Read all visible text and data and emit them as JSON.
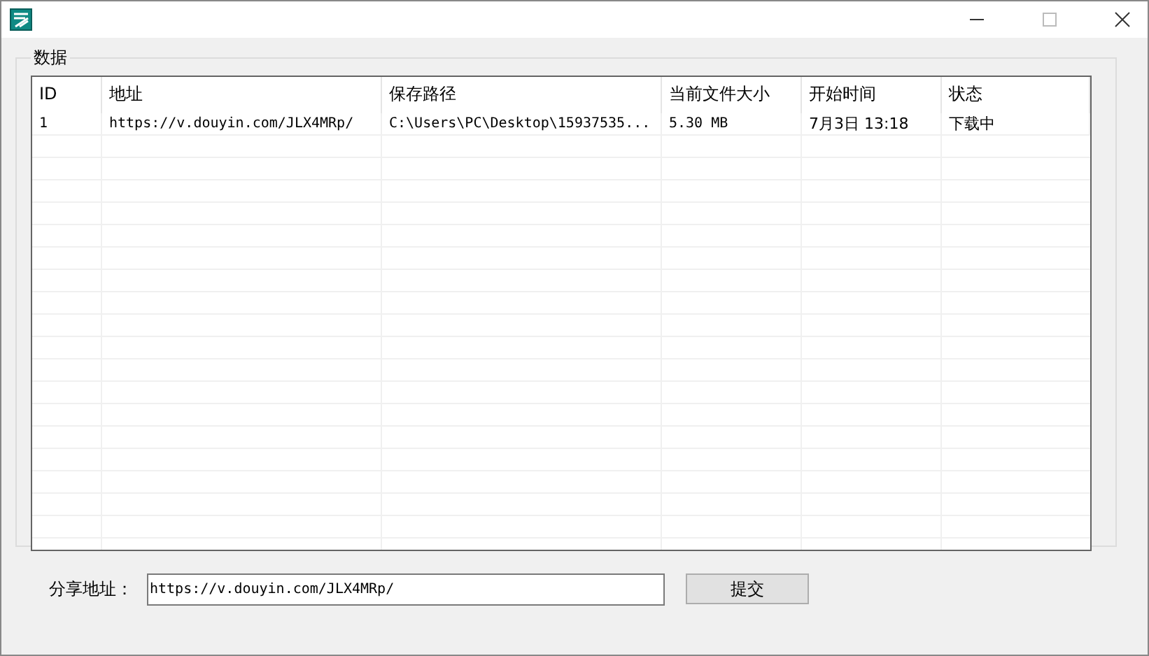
{
  "group": {
    "title": "数据"
  },
  "table": {
    "columns": [
      "ID",
      "地址",
      "保存路径",
      "当前文件大小",
      "开始时间",
      "状态"
    ],
    "rows": [
      [
        "1",
        "https://v.douyin.com/JLX4MRp/",
        "C:\\Users\\PC\\Desktop\\15937535...",
        "5.30 MB",
        "7月3日 13:18",
        "下载中"
      ]
    ]
  },
  "share": {
    "label": "分享地址：",
    "value": "https://v.douyin.com/JLX4MRp/"
  },
  "buttons": [
    "提交"
  ]
}
